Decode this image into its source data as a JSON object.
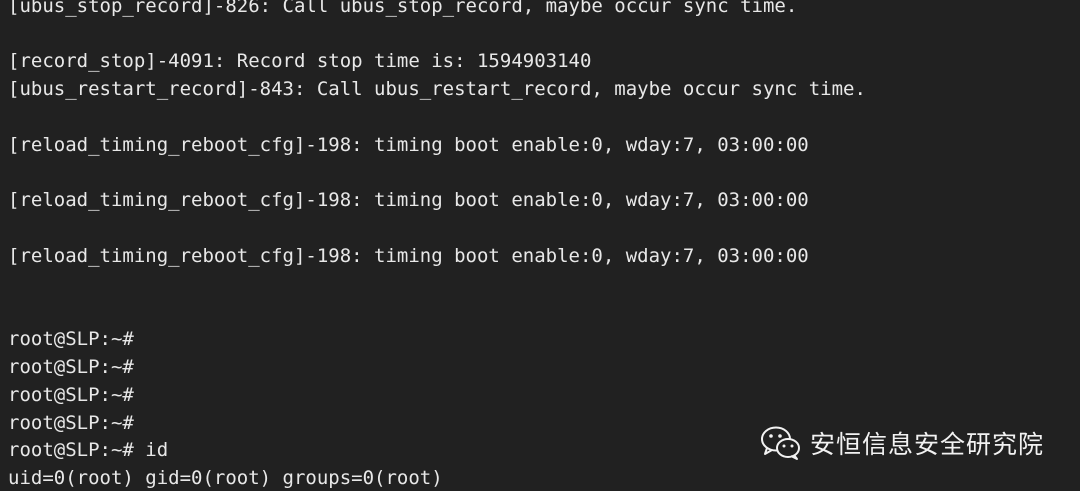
{
  "terminal": {
    "lines": [
      "[ubus_stop_record]-826: Call ubus_stop_record, maybe occur sync time.",
      "",
      "[record_stop]-4091: Record stop time is: 1594903140",
      "[ubus_restart_record]-843: Call ubus_restart_record, maybe occur sync time.",
      "",
      "[reload_timing_reboot_cfg]-198: timing boot enable:0, wday:7, 03:00:00",
      "",
      "[reload_timing_reboot_cfg]-198: timing boot enable:0, wday:7, 03:00:00",
      "",
      "[reload_timing_reboot_cfg]-198: timing boot enable:0, wday:7, 03:00:00",
      "",
      "",
      "root@SLP:~#",
      "root@SLP:~#",
      "root@SLP:~#",
      "root@SLP:~#",
      "root@SLP:~# id",
      "uid=0(root) gid=0(root) groups=0(root)"
    ]
  },
  "watermark": {
    "icon": "wechat-icon",
    "text": "安恒信息安全研究院"
  },
  "colors": {
    "background": "#212121",
    "text": "#e8e8e8"
  }
}
